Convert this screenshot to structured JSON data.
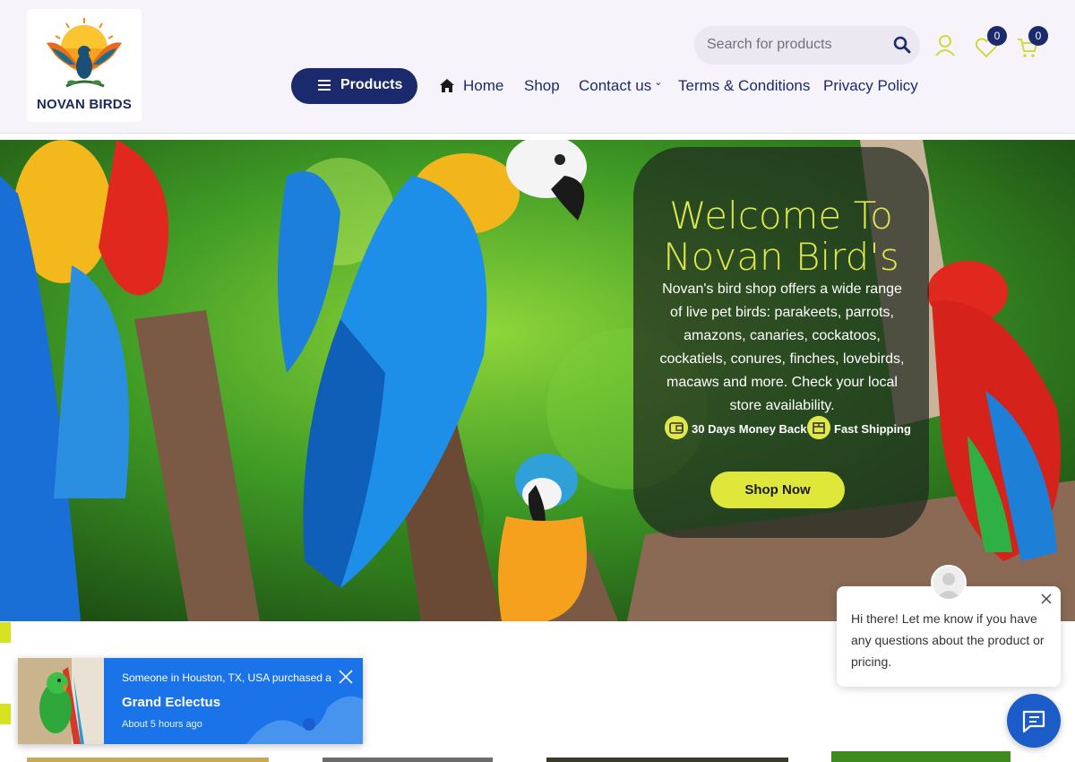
{
  "header": {
    "logo_text": "NOVAN BIRDS",
    "search_placeholder": "Search for products",
    "wishlist_count": "0",
    "cart_count": "0",
    "products_button": "Products",
    "nav": [
      {
        "label": "Home"
      },
      {
        "label": "Shop"
      },
      {
        "label": "Contact us"
      },
      {
        "label": "Terms & Conditions"
      },
      {
        "label": "Privacy Policy"
      }
    ]
  },
  "hero": {
    "title_line1": "Welcome To",
    "title_line2": "Novan Bird's",
    "description": "Novan's bird shop offers a wide range of live pet birds: parakeets, parrots, amazons, canaries, cockatoos, cockatiels, conures, finches, lovebirds, macaws and more. Check your local store availability.",
    "feature_1": "30 Days Money Back",
    "feature_2": "Fast Shipping",
    "cta": "Shop Now"
  },
  "purchase_popup": {
    "line1": "Someone in Houston, TX, USA purchased a",
    "product": "Grand Eclectus",
    "time": "About 5 hours ago"
  },
  "chat": {
    "message": "Hi there! Let me know if you have any questions about the product or pricing."
  },
  "colors": {
    "navy": "#1b2a6c",
    "accent_yellow": "#dfe83a",
    "popup_blue": "#1a73e8",
    "header_bg": "#f7f3fb"
  }
}
